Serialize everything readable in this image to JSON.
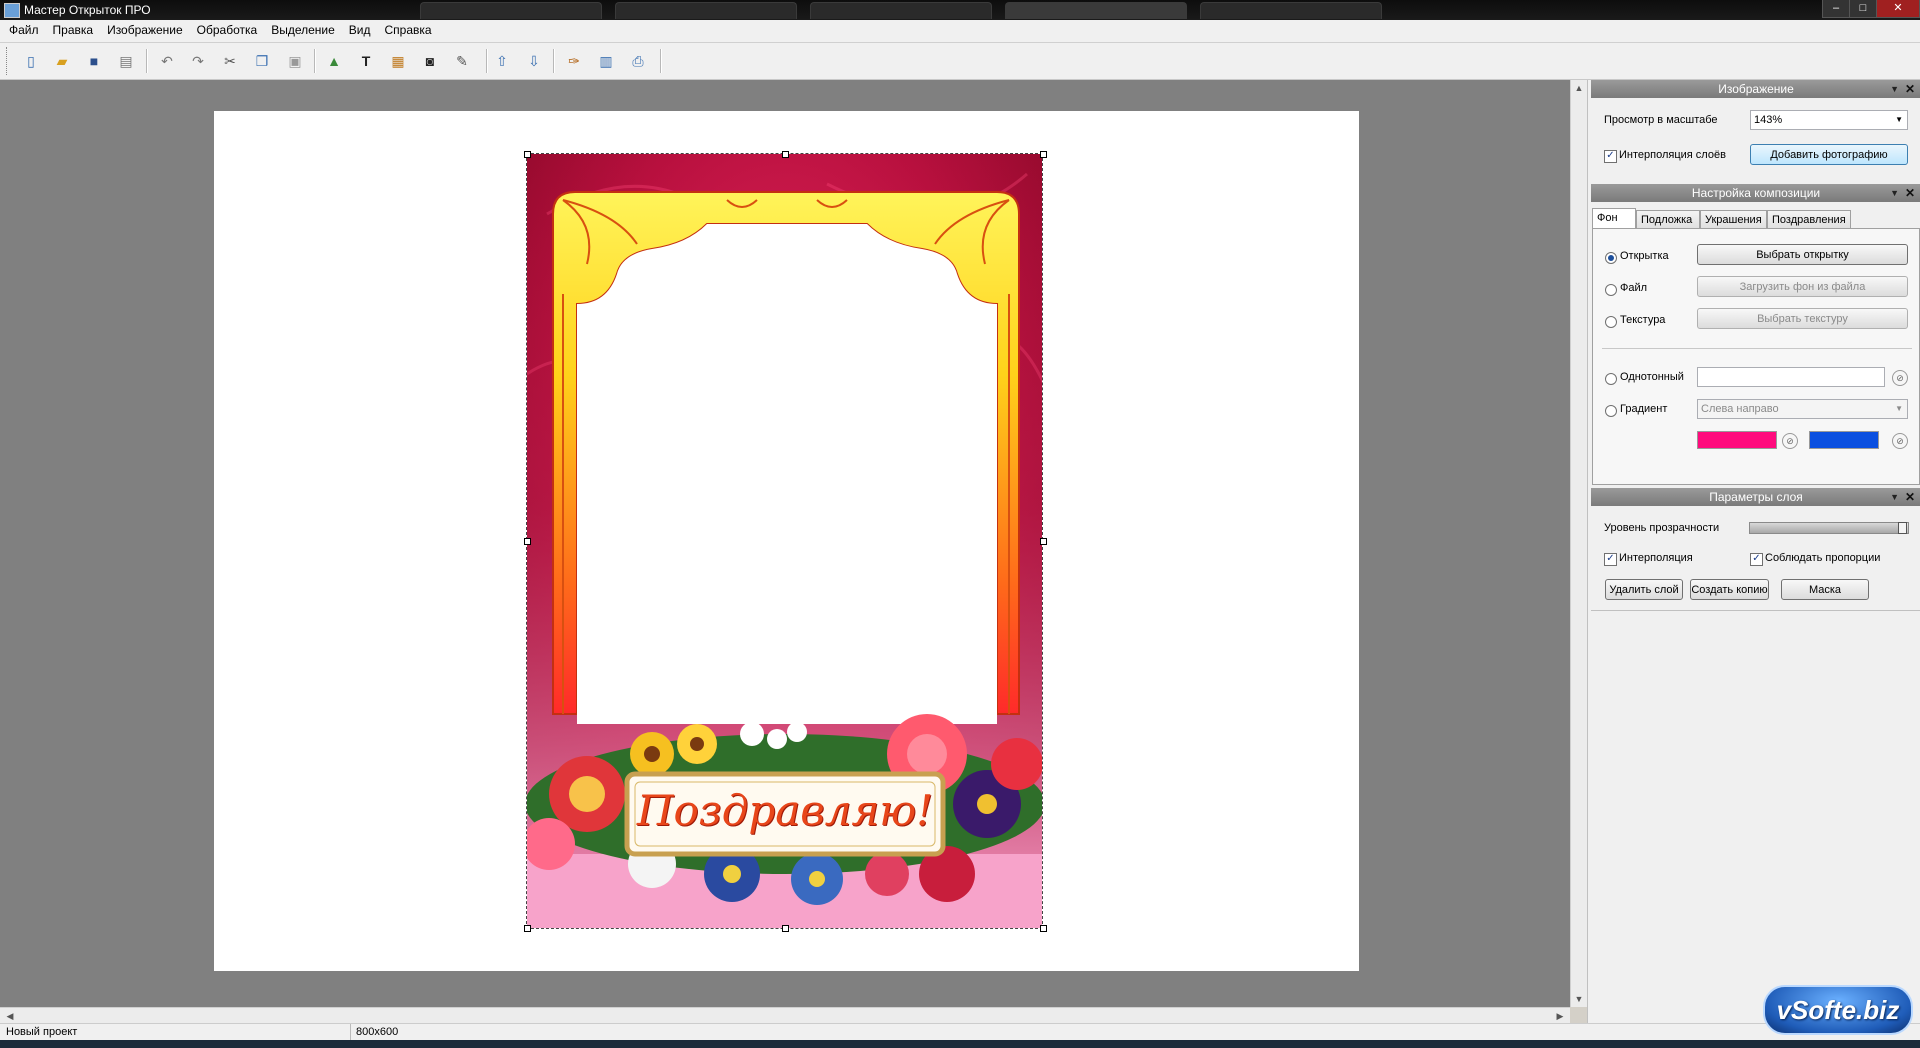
{
  "window": {
    "title": "Мастер Открыток ПРО",
    "minimize": "–",
    "maximize": "□",
    "close": "✕"
  },
  "menu": [
    "Файл",
    "Правка",
    "Изображение",
    "Обработка",
    "Выделение",
    "Вид",
    "Справка"
  ],
  "toolbar": {
    "icons": [
      "new-file-icon",
      "open-folder-icon",
      "save-icon",
      "print-icon",
      "undo-icon",
      "redo-icon",
      "cut-icon",
      "copy-icon",
      "paste-icon",
      "add-image-icon",
      "text-icon",
      "frame-icon",
      "crop-icon",
      "mask-icon",
      "bring-forward-icon",
      "send-backward-icon",
      "text-effect-icon",
      "page-setup-icon",
      "export-icon"
    ],
    "text_tool_glyph": "T"
  },
  "card": {
    "greeting": "Поздравляю!"
  },
  "status": {
    "project": "Новый проект",
    "size": "800x600"
  },
  "panel_image": {
    "title": "Изображение",
    "zoom_label": "Просмотр в масштабе",
    "zoom_value": "143%",
    "interp_label": "Интерполяция слоёв",
    "interp_checked": true,
    "add_photo": "Добавить фотографию"
  },
  "panel_composition": {
    "title": "Настройка композиции",
    "tabs": [
      "Фон",
      "Подложка",
      "Украшения",
      "Поздравления"
    ],
    "active_tab": "Фон",
    "options": {
      "card": "Открытка",
      "file": "Файл",
      "texture": "Текстура",
      "solid": "Однотонный",
      "gradient": "Градиент"
    },
    "selected": "Открытка",
    "choose_card": "Выбрать открытку",
    "load_file": "Загрузить фон из файла",
    "choose_texture": "Выбрать текстуру",
    "solid_value": "",
    "gradient_direction": "Слева направо",
    "gradient_colors": [
      "#ff0a7d",
      "#0a4fe0"
    ]
  },
  "panel_layer": {
    "title": "Параметры слоя",
    "opacity_label": "Уровень прозрачности",
    "opacity": 1.0,
    "interp_label": "Интерполяция",
    "interp_checked": true,
    "keep_ratio_label": "Соблюдать пропорции",
    "keep_ratio_checked": true,
    "delete_layer": "Удалить слой",
    "duplicate": "Создать копию",
    "mask": "Маска"
  },
  "watermark": "vSofte.biz"
}
